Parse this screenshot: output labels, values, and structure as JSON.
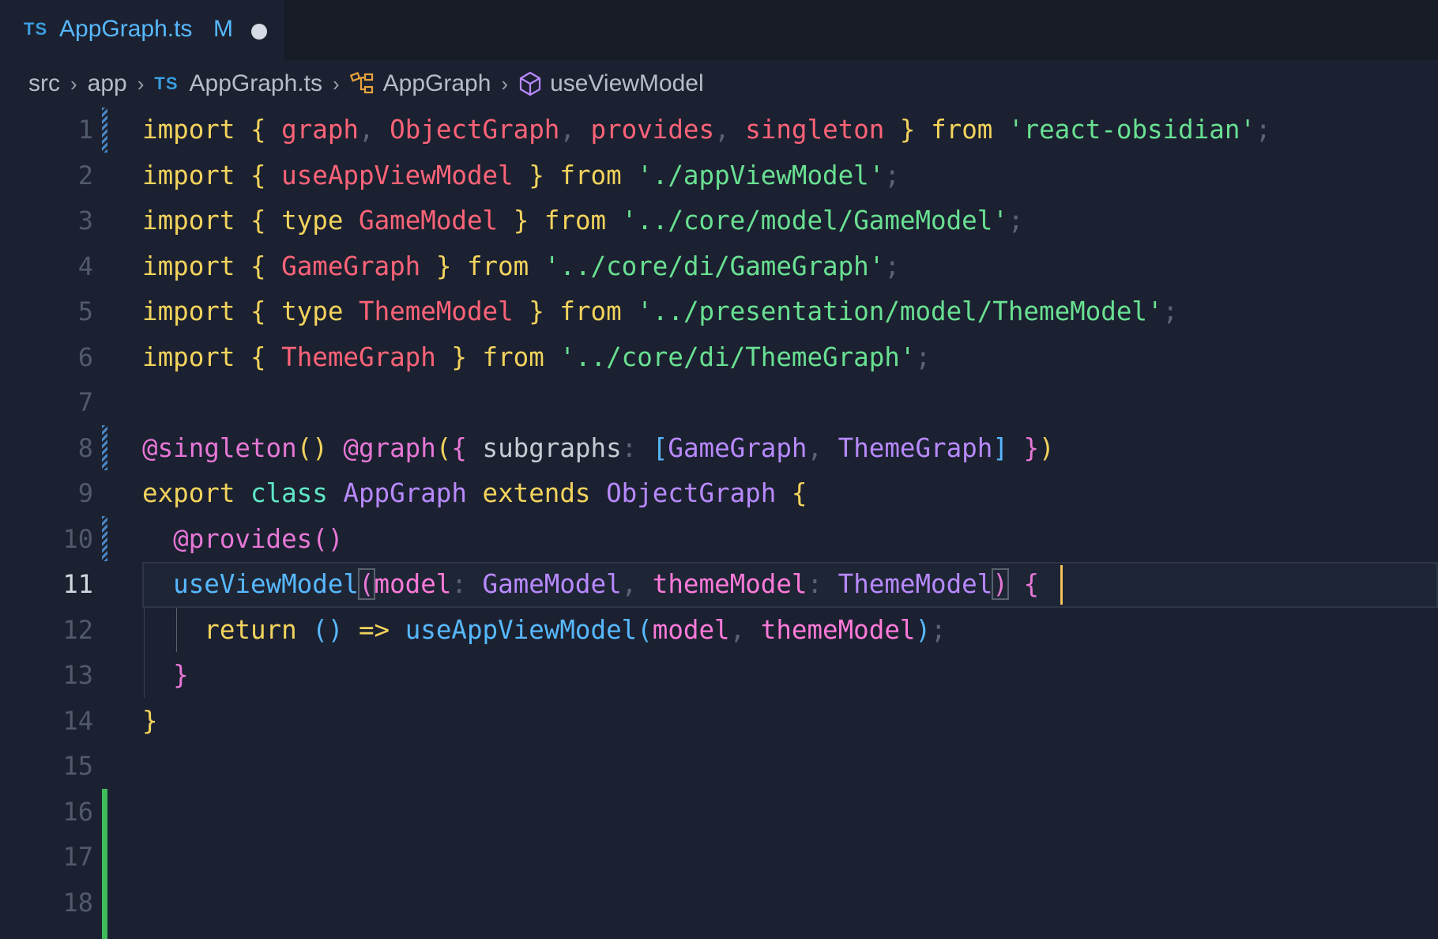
{
  "tab": {
    "lang": "TS",
    "file_name": "AppGraph.ts",
    "status": "M"
  },
  "breadcrumb": {
    "items": [
      "src",
      "app",
      "AppGraph.ts",
      "AppGraph",
      "useViewModel"
    ],
    "ts_label": "TS"
  },
  "lines": {
    "n1": "1",
    "n2": "2",
    "n3": "3",
    "n4": "4",
    "n5": "5",
    "n6": "6",
    "n7": "7",
    "n8": "8",
    "n9": "9",
    "n10": "10",
    "n11": "11",
    "n12": "12",
    "n13": "13",
    "n14": "14",
    "n15": "15",
    "n16": "16",
    "n17": "17",
    "n18": "18"
  },
  "code": {
    "l1": {
      "import": "import",
      "ob": "{",
      "a": "graph",
      "c1": ",",
      "b": "ObjectGraph",
      "c2": ",",
      "c": "provides",
      "c3": ",",
      "d": "singleton",
      "cb": "}",
      "from": "from",
      "str": "'react-obsidian'",
      "semi": ";"
    },
    "l2": {
      "import": "import",
      "ob": "{",
      "a": "useAppViewModel",
      "cb": "}",
      "from": "from",
      "str": "'./appViewModel'",
      "semi": ";"
    },
    "l3": {
      "import": "import",
      "ob": "{",
      "type": "type",
      "a": "GameModel",
      "cb": "}",
      "from": "from",
      "str": "'../core/model/GameModel'",
      "semi": ";"
    },
    "l4": {
      "import": "import",
      "ob": "{",
      "a": "GameGraph",
      "cb": "}",
      "from": "from",
      "str": "'../core/di/GameGraph'",
      "semi": ";"
    },
    "l5": {
      "import": "import",
      "ob": "{",
      "type": "type",
      "a": "ThemeModel",
      "cb": "}",
      "from": "from",
      "str": "'../presentation/model/ThemeModel'",
      "semi": ";"
    },
    "l6": {
      "import": "import",
      "ob": "{",
      "a": "ThemeGraph",
      "cb": "}",
      "from": "from",
      "str": "'../core/di/ThemeGraph'",
      "semi": ";"
    },
    "l8": {
      "dec1": "@singleton",
      "p1": "()",
      "dec2": "@graph",
      "po": "(",
      "ob": "{",
      "key": "subgraphs",
      "colon": ":",
      "lb": "[",
      "a": "GameGraph",
      "comma": ",",
      "b": "ThemeGraph",
      "rb": "]",
      "cb": "}",
      "pc": ")"
    },
    "l9": {
      "export": "export",
      "class": "class",
      "name": "AppGraph",
      "extends": "extends",
      "base": "ObjectGraph",
      "ob": "{"
    },
    "l10": {
      "dec": "@provides",
      "p": "()"
    },
    "l11": {
      "fn": "useViewModel",
      "po": "(",
      "p1": "model",
      "c1": ":",
      "t1": "GameModel",
      "comma": ",",
      "p2": "themeModel",
      "c2": ":",
      "t2": "ThemeModel",
      "pc": ")",
      "ob": "{"
    },
    "l12": {
      "ret": "return",
      "paren": "()",
      "arrow": "=>",
      "fn": "useAppViewModel",
      "po": "(",
      "a1": "model",
      "comma": ",",
      "a2": "themeModel",
      "pc": ")",
      "semi": ";"
    },
    "l13": {
      "cb": "}"
    },
    "l14": {
      "cb": "}"
    }
  },
  "colors": {
    "background": "#1b2130",
    "keyword": "#f3d35d",
    "string": "#69e092",
    "identifier": "#ff6378",
    "decorator": "#e777d6",
    "class_name": "#b889ff",
    "function": "#57b8ff",
    "git_added": "#3ebc5a",
    "git_modified": "#4a86c5"
  }
}
